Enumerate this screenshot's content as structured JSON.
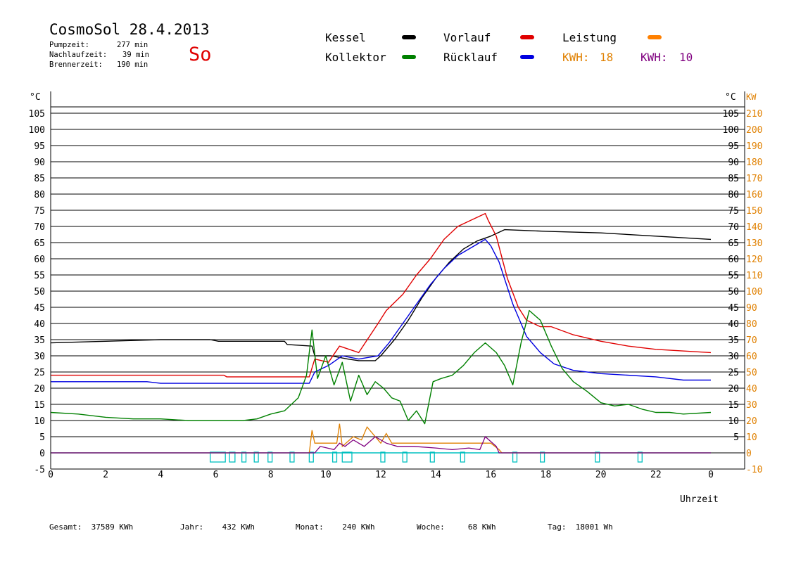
{
  "header": {
    "title": "CosmoSol 28.4.2013",
    "day": "So",
    "stats": [
      {
        "label": "Pumpzeit:",
        "value": "277 min"
      },
      {
        "label": "Nachlaufzeit:",
        "value": "39 min"
      },
      {
        "label": "Brennerzeit:",
        "value": "190 min"
      }
    ]
  },
  "legend": {
    "kessel": {
      "label": "Kessel",
      "color": "#000000"
    },
    "vorlauf": {
      "label": "Vorlauf",
      "color": "#e00000"
    },
    "leistung": {
      "label": "Leistung",
      "color": "#ff8000"
    },
    "kollektor": {
      "label": "Kollektor",
      "color": "#008000"
    },
    "ruecklauf": {
      "label": "Rücklauf",
      "color": "#0000e0"
    },
    "kwh1": {
      "label": "KWH:",
      "value": "18",
      "color": "#e08000"
    },
    "kwh2": {
      "label": "KWH:",
      "value": "10",
      "color": "#800080"
    }
  },
  "totals": {
    "gesamt": "Gesamt:  37589 KWh",
    "jahr": "Jahr:    432 KWh",
    "monat": "Monat:    240 KWh",
    "woche": "Woche:     68 KWh",
    "tag": "Tag:  18001 Wh"
  },
  "chart_data": {
    "type": "line",
    "xlabel": "Uhrzeit",
    "ylabel_left": "°C",
    "ylabel_right_temp": "°C",
    "ylabel_right_power": "KW",
    "xlim": [
      0,
      24
    ],
    "ylim": [
      -5,
      105
    ],
    "x_ticks": [
      "0",
      "2",
      "4",
      "6",
      "8",
      "10",
      "12",
      "14",
      "16",
      "18",
      "20",
      "22",
      "0"
    ],
    "y_ticks_left": [
      "105",
      "100",
      "95",
      "90",
      "85",
      "80",
      "75",
      "70",
      "65",
      "60",
      "55",
      "50",
      "45",
      "40",
      "35",
      "30",
      "25",
      "20",
      "15",
      "10",
      "5",
      "0",
      "-5"
    ],
    "y_ticks_right_temp": [
      "105",
      "100",
      "95",
      "90",
      "85",
      "80",
      "75",
      "70",
      "65",
      "60",
      "55",
      "50",
      "45",
      "40",
      "35",
      "30",
      "25",
      "20",
      "15",
      "10",
      "5"
    ],
    "y_ticks_right_power": [
      "210",
      "200",
      "190",
      "180",
      "170",
      "160",
      "150",
      "140",
      "130",
      "120",
      "110",
      "100",
      "90",
      "80",
      "70",
      "60",
      "50",
      "40",
      "30",
      "20",
      "10",
      "0",
      "-10"
    ],
    "grid": true,
    "series": [
      {
        "name": "Kessel",
        "color": "#000000",
        "x": [
          0,
          2,
          4,
          5.8,
          6.1,
          8.5,
          8.6,
          9.5,
          9.6,
          10.2,
          10.8,
          11.2,
          11.8,
          12.0,
          12.5,
          13,
          13.5,
          14,
          14.5,
          15,
          15.5,
          16,
          16.5,
          18,
          20,
          22,
          24
        ],
        "values": [
          34,
          34.5,
          35,
          35,
          34.5,
          34.5,
          33.5,
          33,
          30,
          30,
          29,
          28.5,
          28.5,
          30,
          35,
          41,
          48,
          54,
          59,
          63,
          65.5,
          67,
          69,
          68.5,
          68,
          67,
          66
        ]
      },
      {
        "name": "Vorlauf",
        "color": "#e00000",
        "x": [
          0,
          6.3,
          6.4,
          9.4,
          9.6,
          10.1,
          10.5,
          11.2,
          11.9,
          12.2,
          12.8,
          13.3,
          13.8,
          14.3,
          14.8,
          15.3,
          15.8,
          15.9,
          16.2,
          16.6,
          17,
          17.3,
          17.8,
          18.2,
          19,
          20,
          21,
          22,
          24
        ],
        "values": [
          24,
          24,
          23.5,
          23.5,
          29,
          28,
          33,
          31,
          40,
          44,
          49,
          55,
          60,
          66,
          70,
          72,
          74,
          72,
          67,
          54,
          45,
          41,
          39,
          39,
          36.5,
          34.5,
          33,
          32,
          31
        ]
      },
      {
        "name": "Rücklauf",
        "color": "#0000e0",
        "x": [
          0,
          3.5,
          4,
          9.4,
          9.6,
          10.1,
          10.6,
          11.2,
          11.9,
          12.3,
          12.8,
          13.3,
          13.8,
          14.3,
          14.8,
          15.3,
          15.8,
          16.0,
          16.3,
          16.8,
          17.3,
          17.8,
          18.3,
          19,
          20,
          22,
          23,
          24
        ],
        "values": [
          22,
          22,
          21.5,
          21.5,
          25,
          27,
          30,
          29,
          30,
          34,
          40,
          46,
          52,
          57,
          61,
          63.5,
          66,
          64,
          59,
          46,
          36,
          31,
          27.5,
          25.5,
          24.5,
          23.5,
          22.5,
          22.5
        ]
      },
      {
        "name": "Kollektor",
        "color": "#008000",
        "x": [
          0,
          1,
          2,
          3,
          4,
          5,
          6,
          7,
          7.5,
          8,
          8.5,
          9.0,
          9.3,
          9.5,
          9.7,
          10.0,
          10.3,
          10.6,
          10.9,
          11.2,
          11.5,
          11.8,
          12.1,
          12.4,
          12.7,
          13.0,
          13.3,
          13.6,
          13.9,
          14.2,
          14.6,
          15.0,
          15.4,
          15.8,
          16.2,
          16.5,
          16.8,
          17.1,
          17.4,
          17.8,
          18.2,
          18.6,
          19.0,
          19.5,
          20,
          20.5,
          21,
          21.5,
          22,
          22.5,
          23,
          24
        ],
        "values": [
          12.5,
          12,
          11,
          10.5,
          10.5,
          10,
          10,
          10,
          10.5,
          12,
          13,
          17,
          24,
          38,
          23,
          30,
          21,
          28,
          16,
          24,
          18,
          22,
          20,
          17,
          16,
          10,
          13,
          9,
          22,
          23,
          24,
          27,
          31,
          34,
          31,
          27,
          21,
          34,
          44,
          41,
          33,
          26,
          22,
          19,
          15.5,
          14.5,
          15,
          13.5,
          12.5,
          12.5,
          12,
          12.5
        ]
      }
    ],
    "power_series": [
      {
        "name": "KWH: 18",
        "color": "#e08000",
        "x": [
          0,
          9.4,
          9.5,
          9.6,
          10.4,
          10.5,
          10.6,
          11.0,
          11.3,
          11.5,
          12.0,
          12.2,
          12.4,
          13,
          14,
          15,
          16,
          16.3,
          16.4,
          24
        ],
        "values": [
          0,
          0,
          7,
          3,
          3,
          9,
          2,
          5,
          4,
          8,
          3,
          6,
          3,
          3,
          3,
          3,
          3,
          1,
          0,
          0
        ]
      },
      {
        "name": "KWH: 10",
        "color": "#800080",
        "x": [
          0,
          9.6,
          9.8,
          10.3,
          10.5,
          10.7,
          11.0,
          11.4,
          11.8,
          12.2,
          12.6,
          13.2,
          14,
          14.6,
          15.2,
          15.6,
          15.8,
          16.2,
          16.3,
          24
        ],
        "values": [
          0,
          0,
          2,
          1,
          3,
          2,
          4,
          2,
          5,
          3,
          2,
          2,
          1.5,
          1,
          1.5,
          1,
          5,
          2,
          0,
          0
        ]
      }
    ],
    "pump_intervals": [
      [
        5.8,
        6.35
      ],
      [
        6.5,
        6.7
      ],
      [
        6.95,
        7.1
      ],
      [
        7.4,
        7.55
      ],
      [
        7.9,
        8.05
      ],
      [
        8.7,
        8.85
      ],
      [
        9.4,
        9.55
      ],
      [
        10.25,
        10.4
      ],
      [
        10.6,
        10.95
      ],
      [
        12.0,
        12.15
      ],
      [
        12.8,
        12.95
      ],
      [
        13.8,
        13.95
      ],
      [
        14.9,
        15.05
      ],
      [
        16.8,
        16.95
      ],
      [
        17.8,
        17.95
      ],
      [
        19.8,
        19.95
      ],
      [
        21.35,
        21.5
      ]
    ],
    "pump_color": "#00c0c0"
  }
}
